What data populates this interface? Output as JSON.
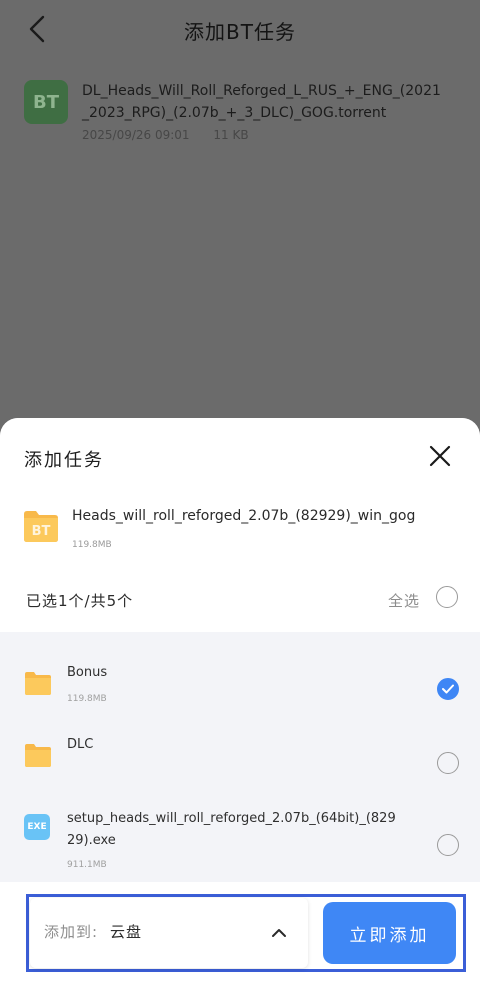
{
  "header": {
    "title": "添加BT任务"
  },
  "torrent": {
    "name": "DL_Heads_Will_Roll_Reforged_L_RUS_+_ENG_(2021_2023_RPG)_(2.07b_+_3_DLC)_GOG.torrent",
    "date": "2025/09/26 09:01",
    "size": "11 KB",
    "icon_text": "BT"
  },
  "sheet": {
    "title": "添加任务",
    "task": {
      "icon_text": "BT",
      "name": "Heads_will_roll_reforged_2.07b_(82929)_win_gog",
      "size": "119.8MB"
    },
    "selection_summary": "已选1个/共5个",
    "select_all_label": "全选",
    "files": [
      {
        "name": "Bonus",
        "size": "119.8MB",
        "type": "folder",
        "checked": true
      },
      {
        "name": "DLC",
        "size": "",
        "type": "folder",
        "checked": false
      },
      {
        "name": "setup_heads_will_roll_reforged_2.07b_(64bit)_(82929).exe",
        "size": "911.1MB",
        "type": "exe",
        "checked": false,
        "icon_text": "EXE"
      }
    ]
  },
  "bottom": {
    "dest_label": "添加到:",
    "dest_value": "云盘",
    "add_button": "立即添加"
  },
  "colors": {
    "accent": "#3e86f5",
    "frame": "#3b5ed7",
    "overlay": "#6b6b6b"
  }
}
